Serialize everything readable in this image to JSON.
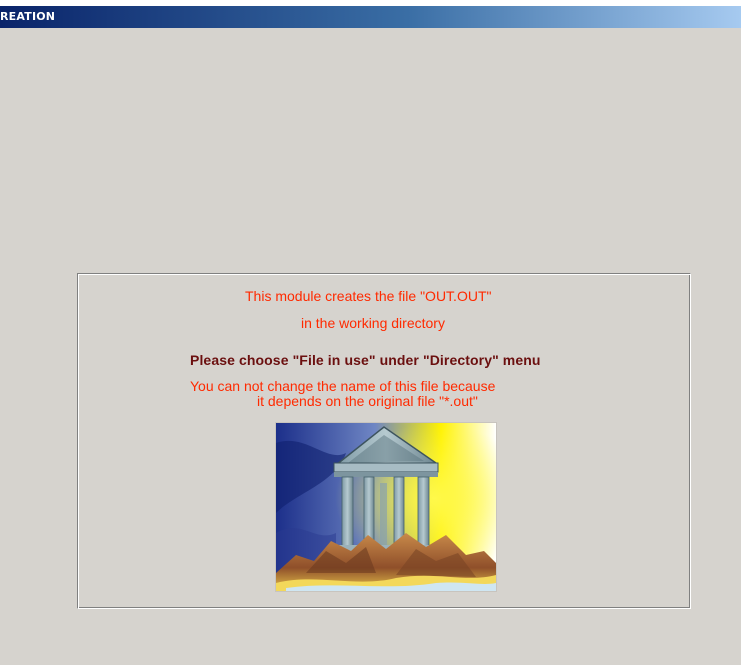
{
  "window": {
    "title": "REATION"
  },
  "panel": {
    "line1": "This module creates the file  \"OUT.OUT\"",
    "line2": "in the working directory",
    "instruction": "Please choose \"File in use\" under \"Directory\" menu",
    "note_line1": "You can not change the name of this file because",
    "note_line2": "it depends on the original file \"*.out\""
  },
  "image": {
    "icon": "greek-temple-on-rock"
  },
  "colors": {
    "background": "#d6d3ce",
    "titlebar_start": "#0a246a",
    "titlebar_end": "#a6caf0",
    "message_red": "#ff2a00",
    "instruction_dark_red": "#6b0f0f"
  }
}
